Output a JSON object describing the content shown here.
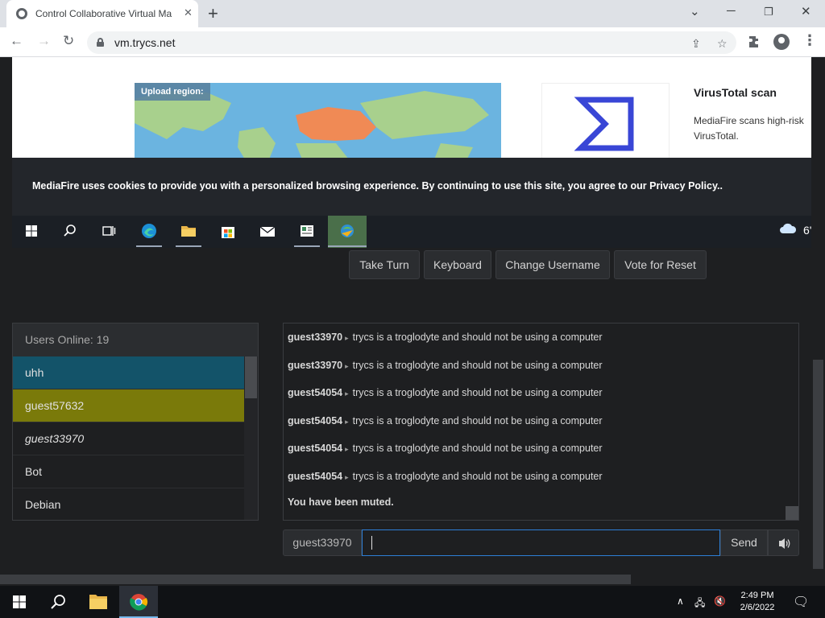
{
  "browser": {
    "tab_title": "Control Collaborative Virtual Ma",
    "url": "vm.trycs.net"
  },
  "vm_screen": {
    "upload_region_label": "Upload region:",
    "virustotal_title": "VirusTotal scan",
    "virustotal_desc": "MediaFire scans high-risk VirusTotal.",
    "cookie_text": "MediaFire uses cookies to provide you with a personalized browsing experience. By continuing to use this site, you agree to our Privacy Policy..",
    "weather_temp": "6'"
  },
  "controls": {
    "take_turn": "Take Turn",
    "keyboard": "Keyboard",
    "change_username": "Change Username",
    "vote_for_reset": "Vote for Reset"
  },
  "users": {
    "header": "Users Online: 19",
    "list": [
      {
        "name": "uhh",
        "color": "#135369"
      },
      {
        "name": "guest57632",
        "color": "#7a7a0a"
      },
      {
        "name": "guest33970",
        "color": "",
        "italic": true
      },
      {
        "name": "Bot",
        "color": ""
      },
      {
        "name": "Debian",
        "color": ""
      }
    ]
  },
  "chat": {
    "messages": [
      {
        "user": "guest33970",
        "text": "trycs is a troglodyte and should not be using a computer"
      },
      {
        "user": "guest33970",
        "text": "trycs is a troglodyte and should not be using a computer"
      },
      {
        "user": "guest54054",
        "text": "trycs is a troglodyte and should not be using a computer"
      },
      {
        "user": "guest54054",
        "text": "trycs is a troglodyte and should not be using a computer"
      },
      {
        "user": "guest54054",
        "text": "trycs is a troglodyte and should not be using a computer"
      },
      {
        "user": "guest54054",
        "text": "trycs is a troglodyte and should not be using a computer"
      }
    ],
    "muted_notice": "You have been muted.",
    "username": "guest33970",
    "input_value": "",
    "send_label": "Send"
  },
  "taskbar": {
    "time": "2:49 PM",
    "date": "2/6/2022"
  },
  "colors": {
    "accent_blue": "#2e7fd6",
    "user_highlight_teal": "#135369",
    "user_highlight_olive": "#7a7a0a"
  }
}
